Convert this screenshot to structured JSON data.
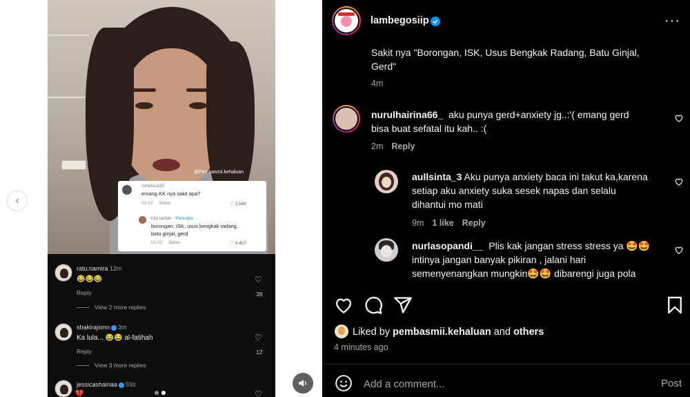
{
  "media": {
    "watermark": "@Pembasmii.kehaluan",
    "card": {
      "comment_user": "Amelia.a15",
      "comment_text": "emang KK nya sakit apa?",
      "comment_date": "01-02",
      "comment_reply": "Balas",
      "comment_likes": "1.566",
      "reply_user": "lula lahfah",
      "reply_creator": "Pencipta",
      "reply_text_1": "borongan, ISK, usus bengkak radang,",
      "reply_text_2": "batu ginjal, gerd",
      "reply_date": "01-02",
      "reply_reply": "Balas",
      "reply_likes": "4.407"
    },
    "tiktok_comments": [
      {
        "user": "ratu.namira",
        "time": "12m",
        "text": "😂😂😂",
        "reply": "Reply",
        "view_more": "View 2 more replies",
        "likes": "38"
      },
      {
        "user": "shakirajsmn",
        "time": "3m",
        "text": "Ka lula... 😂😂 al-fatihah",
        "reply": "Reply",
        "view_more": "View 3 more replies",
        "likes": "12"
      },
      {
        "user": "jessicashainaa",
        "time": "59s",
        "text": "💔"
      }
    ],
    "prev_icon": "‹",
    "carousel": {
      "count": 2,
      "active_index": 2
    }
  },
  "header": {
    "username": "lambegosiip",
    "more_icon": "···"
  },
  "comments": {
    "top_text_1": "Sakit nya \"Borongan, ISK, Usus Bengkak Radang, Batu Ginjal,",
    "top_text_2": "Gerd\"",
    "top_time": "4m",
    "items": [
      {
        "user": "nurulhairina66_",
        "line1": "aku punya gerd+anxiety jg..:'( emang gerd",
        "line2": "bisa buat sefatal itu kah.. :(",
        "time": "2m",
        "reply": "Reply"
      },
      {
        "user": "aullsinta_3",
        "line1": "Aku punya anxiety baca ini takut ka,karena",
        "line2": "setiap aku anxiety suka sesek napas dan selalu",
        "line3": "dihantui mo mati",
        "time": "9m",
        "likes": "1 like",
        "reply": "Reply"
      },
      {
        "user": "nurlasopandi__",
        "line1": "Plis kak jangan stress stress ya 🤩🤩",
        "line2": "intinya jangan banyak pikiran , jalani hari",
        "line3": "semenyenangkan mungkin🤩🤩 dibarengi juga pola"
      }
    ]
  },
  "likes": {
    "prefix": "Liked by",
    "user": "pembasmii.kehaluan",
    "and": "and",
    "others": "others"
  },
  "post_time": "4 minutes ago",
  "composer": {
    "placeholder": "Add a comment...",
    "post_label": "Post"
  },
  "colors": {
    "background": "#000000",
    "text": "#f5f5f5",
    "secondary_text": "#a8a8a8",
    "verified": "#0095f6"
  },
  "icons": [
    "heart-icon",
    "comment-icon",
    "share-icon",
    "bookmark-icon",
    "emoji-icon",
    "more-icon",
    "verified-icon",
    "audio-icon",
    "chevron-left-icon"
  ]
}
